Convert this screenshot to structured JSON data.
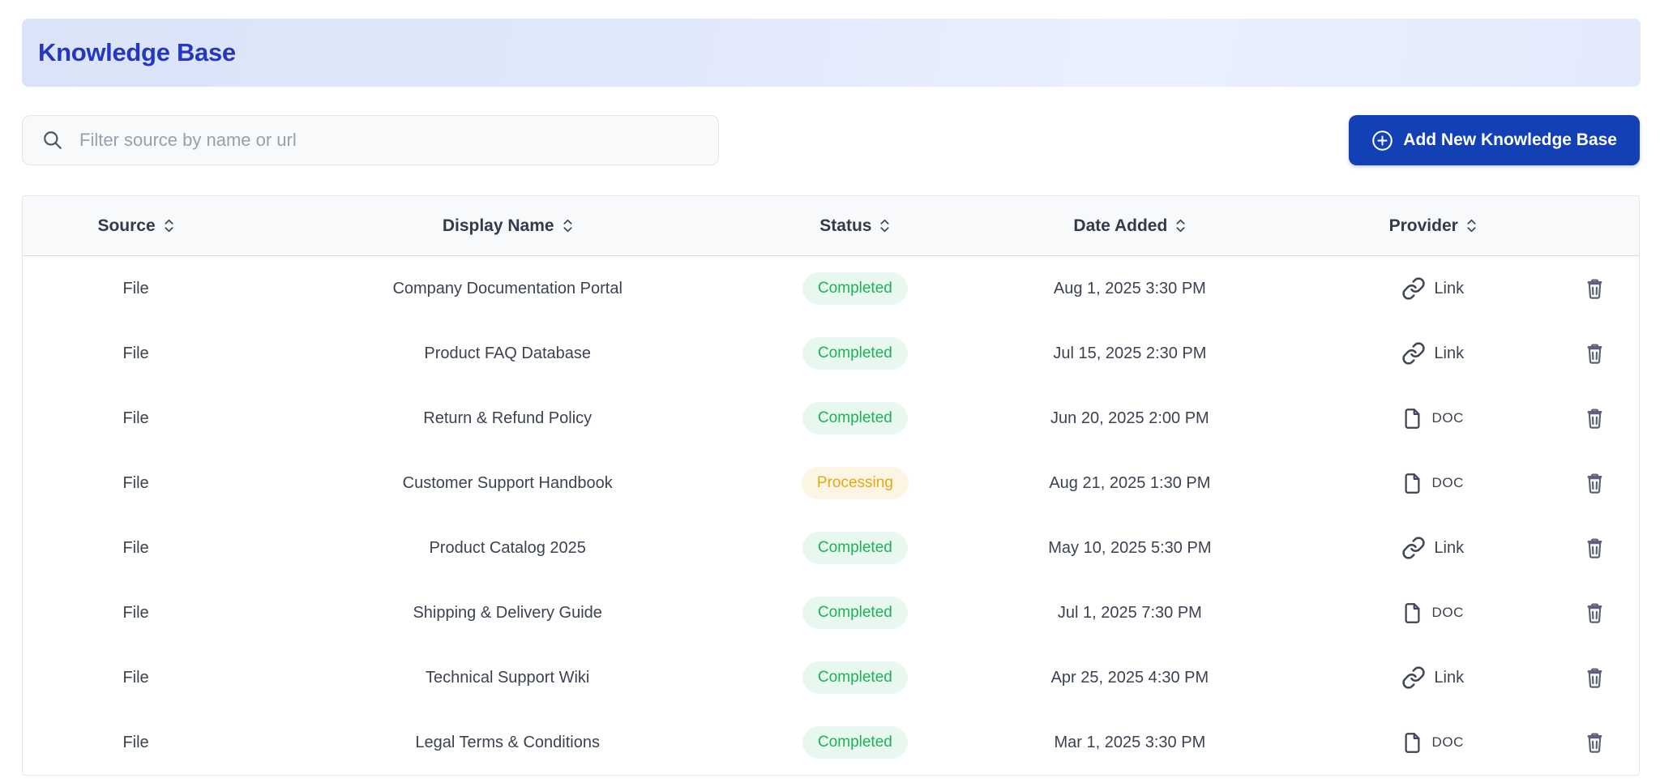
{
  "page": {
    "title": "Knowledge Base"
  },
  "toolbar": {
    "filter_placeholder": "Filter source by name or url",
    "filter_value": "",
    "add_button_label": "Add New Knowledge Base"
  },
  "table": {
    "columns": [
      {
        "label": "Source"
      },
      {
        "label": "Display Name"
      },
      {
        "label": "Status"
      },
      {
        "label": "Date Added"
      },
      {
        "label": "Provider"
      }
    ],
    "rows": [
      {
        "source": "File",
        "name": "Company Documentation Portal",
        "status": "Completed",
        "status_type": "completed",
        "date": "Aug 1, 2025 3:30 PM",
        "provider": "Link",
        "provider_type": "link"
      },
      {
        "source": "File",
        "name": "Product FAQ Database",
        "status": "Completed",
        "status_type": "completed",
        "date": "Jul 15, 2025 2:30 PM",
        "provider": "Link",
        "provider_type": "link"
      },
      {
        "source": "File",
        "name": "Return & Refund Policy",
        "status": "Completed",
        "status_type": "completed",
        "date": "Jun 20, 2025 2:00 PM",
        "provider": "DOC",
        "provider_type": "doc"
      },
      {
        "source": "File",
        "name": "Customer Support Handbook",
        "status": "Processing",
        "status_type": "processing",
        "date": "Aug 21, 2025 1:30 PM",
        "provider": "DOC",
        "provider_type": "doc"
      },
      {
        "source": "File",
        "name": "Product Catalog 2025",
        "status": "Completed",
        "status_type": "completed",
        "date": "May 10, 2025 5:30 PM",
        "provider": "Link",
        "provider_type": "link"
      },
      {
        "source": "File",
        "name": "Shipping & Delivery Guide",
        "status": "Completed",
        "status_type": "completed",
        "date": "Jul 1, 2025 7:30 PM",
        "provider": "DOC",
        "provider_type": "doc"
      },
      {
        "source": "File",
        "name": "Technical Support Wiki",
        "status": "Completed",
        "status_type": "completed",
        "date": "Apr 25, 2025 4:30 PM",
        "provider": "Link",
        "provider_type": "link"
      },
      {
        "source": "File",
        "name": "Legal Terms & Conditions",
        "status": "Completed",
        "status_type": "completed",
        "date": "Mar 1, 2025 3:30 PM",
        "provider": "DOC",
        "provider_type": "doc"
      }
    ]
  },
  "colors": {
    "title_blue": "#2337c3",
    "button_blue": "#1341b5",
    "banner_blue": "#dfe7fa",
    "status_completed_text": "#1cb257",
    "status_completed_bg": "#e9f8ef",
    "status_processing_text": "#e5a915",
    "status_processing_bg": "#fcf5e4"
  }
}
